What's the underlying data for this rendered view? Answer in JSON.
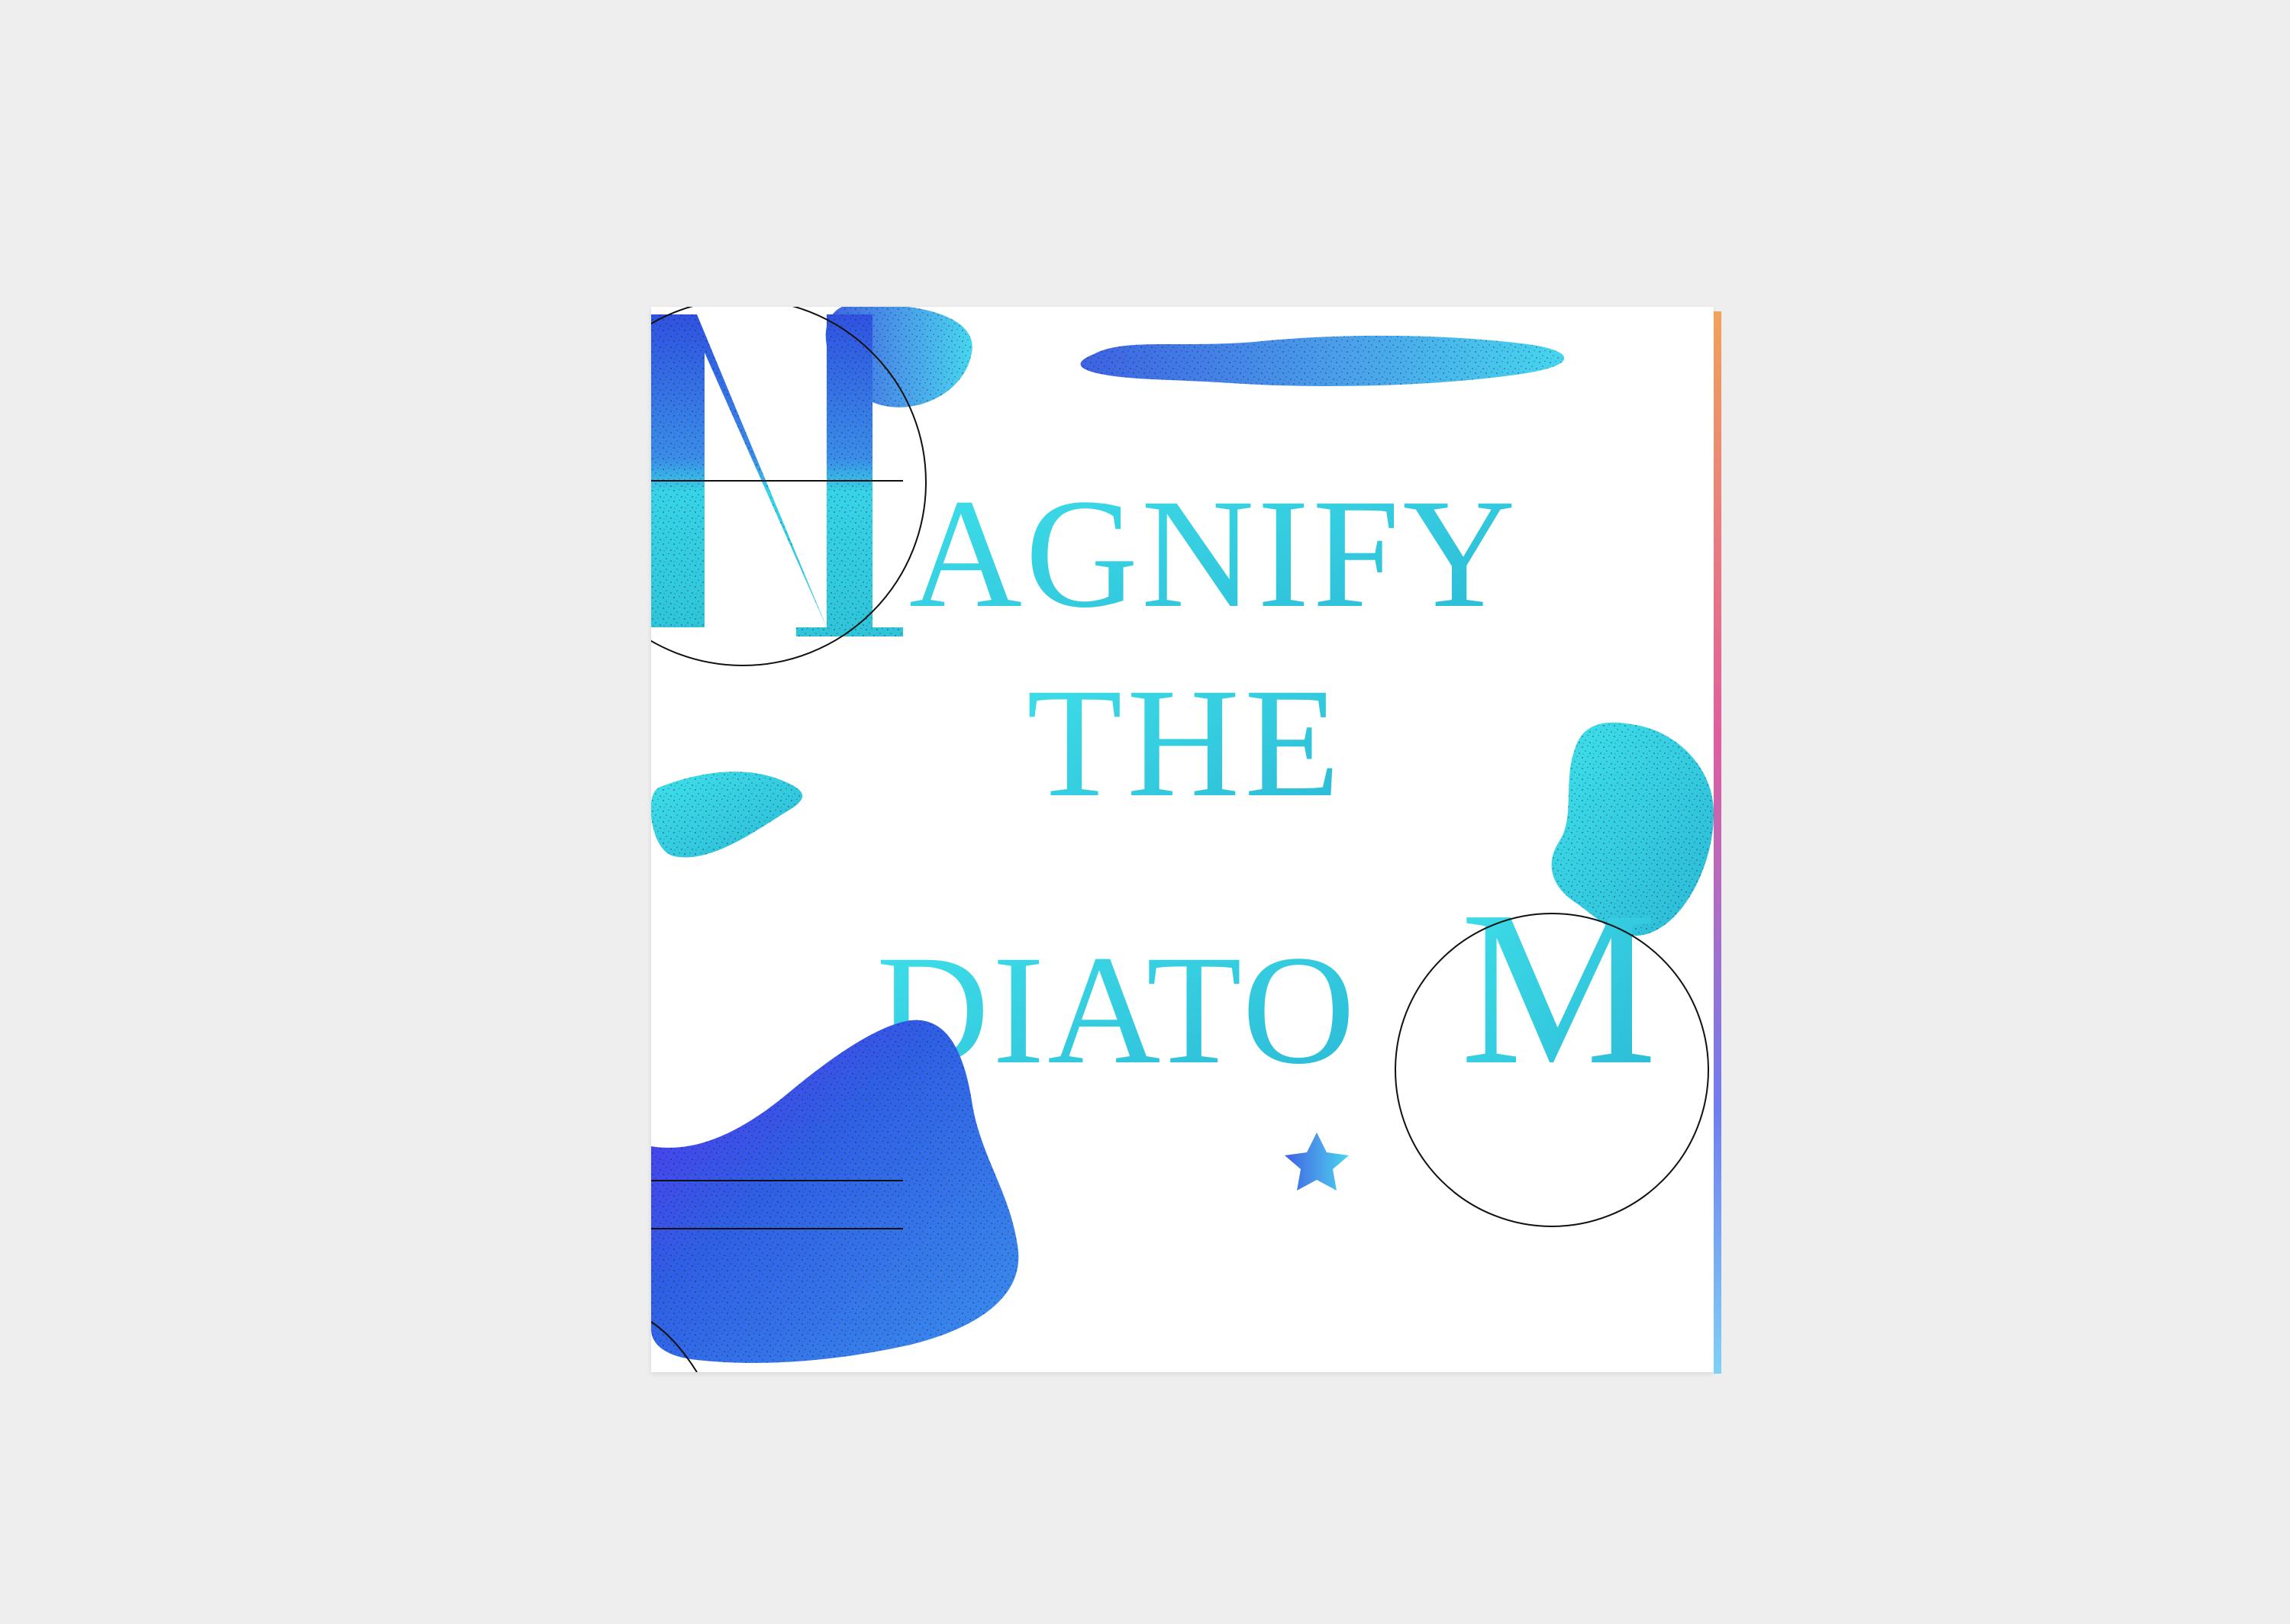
{
  "cover": {
    "line1": "MAGNIFY",
    "line2": "THE",
    "line3": "DIATOM",
    "line1_rest": "AGNIFY",
    "line3_rest": "DIATO",
    "initial_m": "M",
    "final_m": "M"
  },
  "colors": {
    "background": "#eeeeee",
    "paper": "#ffffff",
    "blue_deep": "#2f52e0",
    "blue_mid": "#4a7fe6",
    "cyan": "#3fe0ea",
    "teal": "#2dbfd0",
    "violet": "#6b3df0",
    "ink": "#111111"
  }
}
